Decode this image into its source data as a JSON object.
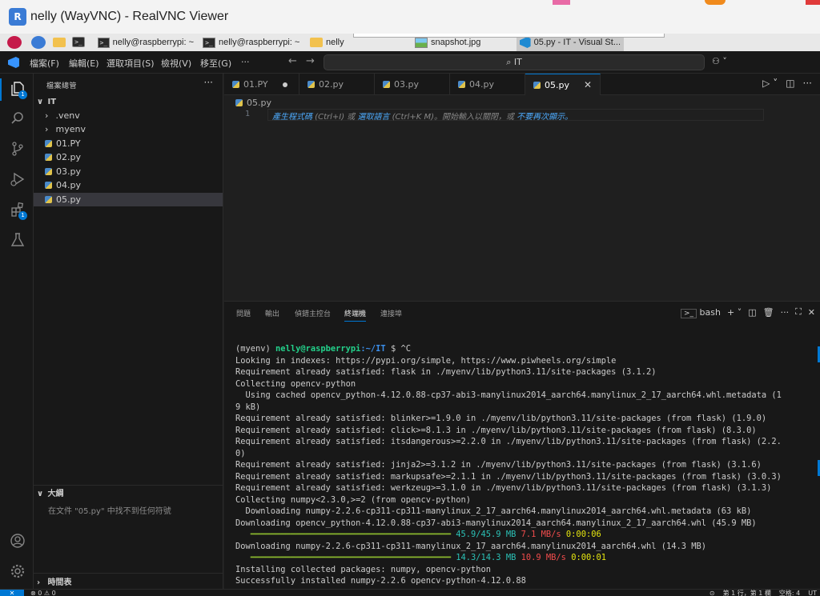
{
  "vnc": {
    "title": "nelly (WayVNC) - RealVNC Viewer",
    "logo": "R"
  },
  "taskbar": {
    "tasks": [
      {
        "label": "nelly@raspberrypi: ~",
        "icon": "terminal-icon"
      },
      {
        "label": "nelly@raspberrypi: ~",
        "icon": "terminal-icon"
      },
      {
        "label": "nelly",
        "icon": "folder-icon"
      },
      {
        "label": "snapshot.jpg",
        "icon": "image-icon"
      },
      {
        "label": "05.py - IT - Visual St...",
        "icon": "vscode-icon"
      }
    ],
    "terminal_glyph": ">_"
  },
  "menu": {
    "items": [
      "檔案(F)",
      "編輯(E)",
      "選取項目(S)",
      "檢視(V)",
      "移至(G)",
      "···"
    ],
    "back": "←",
    "forward": "→",
    "command_center": "⌕ IT",
    "copilot": "⚇ ˅"
  },
  "activity": {
    "explorer_badge": "1",
    "extensions_badge": "1",
    "icons": [
      "files-icon",
      "search-icon",
      "source-control-icon",
      "run-debug-icon",
      "extensions-icon",
      "testing-icon",
      "account-icon",
      "settings-icon"
    ]
  },
  "sidebar": {
    "title": "檔案總管",
    "more": "···",
    "root": "IT",
    "root_chevron": "∨",
    "folders": [
      ".venv",
      "myenv"
    ],
    "folder_chevron": "›",
    "files": [
      "01.PY",
      "02.py",
      "03.py",
      "04.py",
      "05.py"
    ],
    "selected": "05.py",
    "outline_title": "大綱",
    "outline_message": "在文件 \"05.py\" 中找不到任何符號",
    "timeline_title": "時間表",
    "section_chevron_open": "∨",
    "section_chevron_closed": "›"
  },
  "editor": {
    "tabs": [
      {
        "label": "01.PY",
        "dirty": true
      },
      {
        "label": "02.py",
        "dirty": false
      },
      {
        "label": "03.py",
        "dirty": false
      },
      {
        "label": "04.py",
        "dirty": false
      },
      {
        "label": "05.py",
        "dirty": false
      }
    ],
    "active_tab": "05.py",
    "close_glyph": "✕",
    "breadcrumb": "05.py",
    "line_number": "1",
    "hint": {
      "link1": "產生程式碼",
      "text1": " (Ctrl+I) 或 ",
      "link2": "選取語言",
      "text2": " (Ctrl+K M)。開始輸入以關閉，或 ",
      "link3": "不要再次顯示。"
    },
    "actions": [
      "▷ ˅",
      "◫",
      "···"
    ]
  },
  "panel": {
    "tabs": [
      "問題",
      "輸出",
      "偵錯主控台",
      "終端機",
      "連接埠"
    ],
    "active_tab": "終端機",
    "shell": "bash",
    "actions": [
      "+ ˅",
      "◫",
      "🗑",
      "···",
      "⛶",
      "✕"
    ]
  },
  "terminal": {
    "prompt_env": "(myenv) ",
    "prompt_user": "nelly@raspberrypi",
    "prompt_path": ":~/IT",
    "prompt_tail": " $ ^C",
    "lines": [
      "Looking in indexes: https://pypi.org/simple, https://www.piwheels.org/simple",
      "Requirement already satisfied: flask in ./myenv/lib/python3.11/site-packages (3.1.2)",
      "Collecting opencv-python",
      "  Using cached opencv_python-4.12.0.88-cp37-abi3-manylinux2014_aarch64.manylinux_2_17_aarch64.whl.metadata (1",
      "9 kB)",
      "Requirement already satisfied: blinker>=1.9.0 in ./myenv/lib/python3.11/site-packages (from flask) (1.9.0)",
      "Requirement already satisfied: click>=8.1.3 in ./myenv/lib/python3.11/site-packages (from flask) (8.3.0)",
      "Requirement already satisfied: itsdangerous>=2.2.0 in ./myenv/lib/python3.11/site-packages (from flask) (2.2.",
      "0)",
      "Requirement already satisfied: jinja2>=3.1.2 in ./myenv/lib/python3.11/site-packages (from flask) (3.1.6)",
      "Requirement already satisfied: markupsafe>=2.1.1 in ./myenv/lib/python3.11/site-packages (from flask) (3.0.3)",
      "Requirement already satisfied: werkzeug>=3.1.0 in ./myenv/lib/python3.11/site-packages (from flask) (3.1.3)",
      "Collecting numpy<2.3.0,>=2 (from opencv-python)",
      "  Downloading numpy-2.2.6-cp311-cp311-manylinux_2_17_aarch64.manylinux2014_aarch64.whl.metadata (63 kB)",
      "Downloading opencv_python-4.12.0.88-cp37-abi3-manylinux2014_aarch64.manylinux_2_17_aarch64.whl (45.9 MB)"
    ],
    "progress1": {
      "bar": "   ━━━━━━━━━━━━━━━━━━━━━━━━━━━━━━━━━━━━━━━━ ",
      "size": "45.9/45.9 MB",
      "rate": "7.1 MB/s",
      "eta": "0:00:06"
    },
    "line_after1": "Downloading numpy-2.2.6-cp311-cp311-manylinux_2_17_aarch64.manylinux2014_aarch64.whl (14.3 MB)",
    "progress2": {
      "bar": "   ━━━━━━━━━━━━━━━━━━━━━━━━━━━━━━━━━━━━━━━━ ",
      "size": "14.3/14.3 MB",
      "rate": "10.9 MB/s",
      "eta": "0:00:01"
    },
    "final_lines": [
      "Installing collected packages: numpy, opencv-python",
      "Successfully installed numpy-2.2.6 opencv-python-4.12.0.88"
    ]
  },
  "status": {
    "remote": "✕",
    "problems": "⊗ 0 ⚠ 0",
    "right": [
      "⊙",
      "第 1 行，第 1 欄",
      "空格: 4",
      "UT"
    ]
  },
  "colors": {
    "accent": "#0078d4",
    "terminal_green": "#23d18b",
    "terminal_blue": "#3b8eea"
  }
}
